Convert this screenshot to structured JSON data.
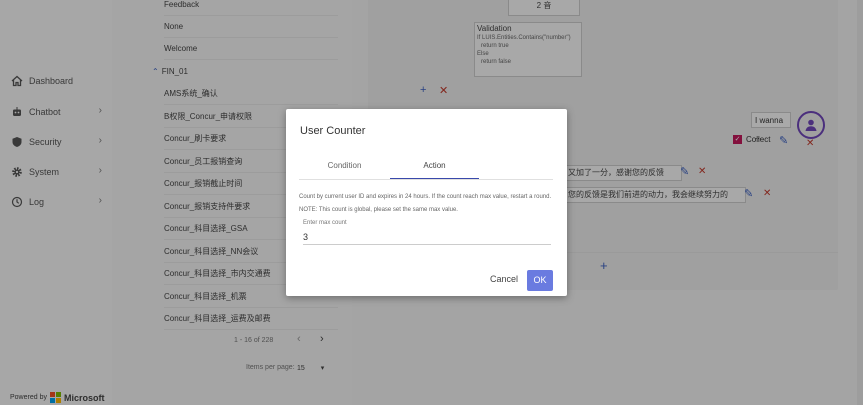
{
  "sidebar": {
    "items": [
      {
        "label": "Dashboard",
        "icon": "home-icon",
        "has_chevron": false
      },
      {
        "label": "Chatbot",
        "icon": "robot-icon",
        "has_chevron": true
      },
      {
        "label": "Security",
        "icon": "shield-icon",
        "has_chevron": true
      },
      {
        "label": "System",
        "icon": "gear-icon",
        "has_chevron": true
      },
      {
        "label": "Log",
        "icon": "history-icon",
        "has_chevron": true
      }
    ],
    "powered_by": "Powered by",
    "brand": "Microsoft"
  },
  "tree": {
    "top_items": [
      "Feedback",
      "None",
      "Welcome"
    ],
    "category": "FIN_01",
    "category_icon": "chevron-up-icon",
    "items": [
      "AMS系统_确认",
      "B权限_Concur_申请权限",
      "Concur_刷卡要求",
      "Concur_员工报销查询",
      "Concur_报销截止时间",
      "Concur_报销支持件要求",
      "Concur_科目选择_GSA",
      "Concur_科目选择_NN会议",
      "Concur_科目选择_市内交通费",
      "Concur_科目选择_机票",
      "Concur_科目选择_运费及邮费"
    ],
    "pager": {
      "range": "1 - 16 of 228",
      "items_per_page_label": "Items per page:",
      "items_per_page": "15"
    }
  },
  "content": {
    "count_value": "2 音",
    "validation": {
      "title": "Validation",
      "lines": [
        "If LUIS.Entities.Contains(\"number\")",
        "return true",
        "Else",
        "return false"
      ]
    },
    "user_input": "I wanna ...",
    "collect_label": "Collect",
    "replies": [
      "又加了一分，感谢您的反馈",
      "您的反馈是我们前进的动力，我会继续努力的"
    ]
  },
  "dialog": {
    "title": "User Counter",
    "tabs": [
      {
        "label": "Condition",
        "active": false
      },
      {
        "label": "Action",
        "active": true
      }
    ],
    "description": "Count by current user ID and expires in 24 hours. If the count reach max value, restart a round. NOTE: This count is global, please set the same max value.",
    "field_label": "Enter max count",
    "field_value": "3",
    "cancel_label": "Cancel",
    "ok_label": "OK"
  },
  "colors": {
    "accent": "#3949ab",
    "ok_button": "#6a7be0",
    "avatar": "#6f46b8",
    "checkbox": "#c2185b",
    "delete": "#c0392b"
  }
}
